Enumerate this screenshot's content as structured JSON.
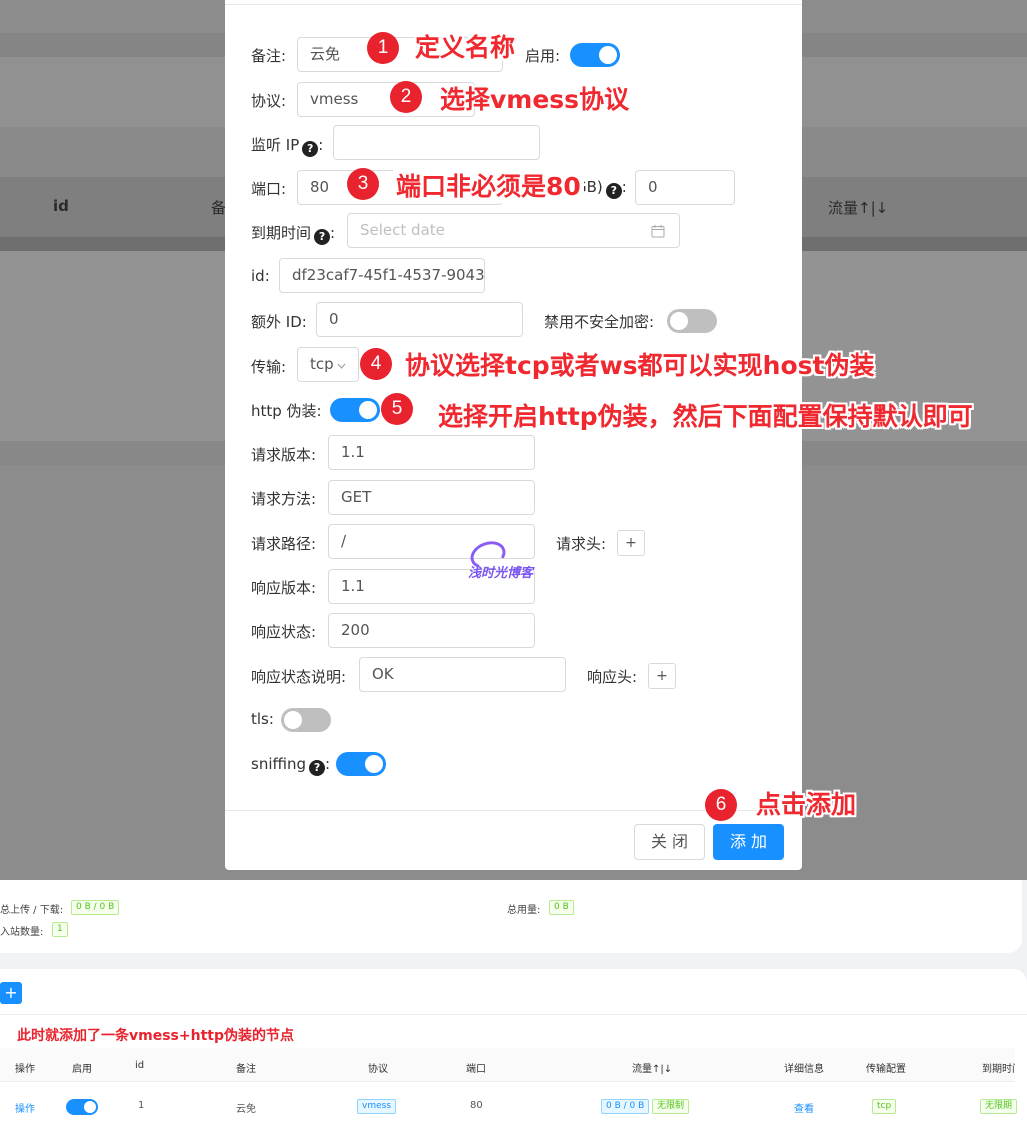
{
  "background": {
    "header_id": "id",
    "header_remark": "备",
    "header_traffic": "流量↑|↓"
  },
  "form": {
    "remark_label": "备注:",
    "remark_value": "云免",
    "enable_label": "启用:",
    "protocol_label": "协议:",
    "protocol_value": "vmess",
    "listen_ip_label": "监听 IP",
    "port_label": "端口:",
    "port_value": "80",
    "total_gb_suffix": "GB)",
    "total_gb_value": "0",
    "expire_label": "到期时间",
    "expire_placeholder": "Select date",
    "id_label": "id:",
    "id_value": "df23caf7-45f1-4537-9043-",
    "alter_id_label": "额外 ID:",
    "alter_id_value": "0",
    "disable_insecure_label": "禁用不安全加密:",
    "transport_label": "传输:",
    "transport_value": "tcp",
    "http_camouflage_label": "http 伪装:",
    "request_version_label": "请求版本:",
    "request_version_value": "1.1",
    "request_method_label": "请求方法:",
    "request_method_value": "GET",
    "request_path_label": "请求路径:",
    "request_path_value": "/",
    "request_header_label": "请求头:",
    "response_version_label": "响应版本:",
    "response_version_value": "1.1",
    "response_status_label": "响应状态:",
    "response_status_value": "200",
    "response_status_desc_label": "响应状态说明:",
    "response_status_desc_value": "OK",
    "response_header_label": "响应头:",
    "tls_label": "tls:",
    "sniffing_label": "sniffing",
    "plus": "+",
    "colon": ":",
    "q_mark": "?"
  },
  "buttons": {
    "close": "关 闭",
    "add": "添 加"
  },
  "annotations": {
    "n1": "1",
    "t1": "定义名称",
    "n2": "2",
    "t2": "选择vmess协议",
    "n3": "3",
    "t3": "端口非必须是80",
    "n4": "4",
    "t4": "协议选择tcp或者ws都可以实现host伪装",
    "n5": "5",
    "t5": "选择开启http伪装，然后下面配置保持默认即可",
    "n6": "6",
    "t6": "点击添加",
    "bottom_note": "此时就添加了一条vmess+http伪装的节点"
  },
  "watermark": "浅时光博客",
  "stats": {
    "upload_download_label": "总上传 / 下载:",
    "upload_download_value": "0 B / 0 B",
    "total_usage_label": "总用量:",
    "total_usage_value": "0 B",
    "inbound_count_label": "入站数量:",
    "inbound_count_value": "1"
  },
  "add_button": "+",
  "table": {
    "headers": [
      "操作",
      "启用",
      "id",
      "备注",
      "协议",
      "端口",
      "流量↑|↓",
      "详细信息",
      "传输配置",
      "到期时间"
    ],
    "row": {
      "action": "操作",
      "id": "1",
      "remark": "云免",
      "protocol": "vmess",
      "port": "80",
      "traffic": "0 B / 0 B",
      "limit": "无限制",
      "detail": "查看",
      "transport": "tcp",
      "expire": "无限期"
    }
  },
  "colors": {
    "primary": "#1890ff",
    "annotation": "#f0282f",
    "overlay": "#8c8c8c"
  }
}
